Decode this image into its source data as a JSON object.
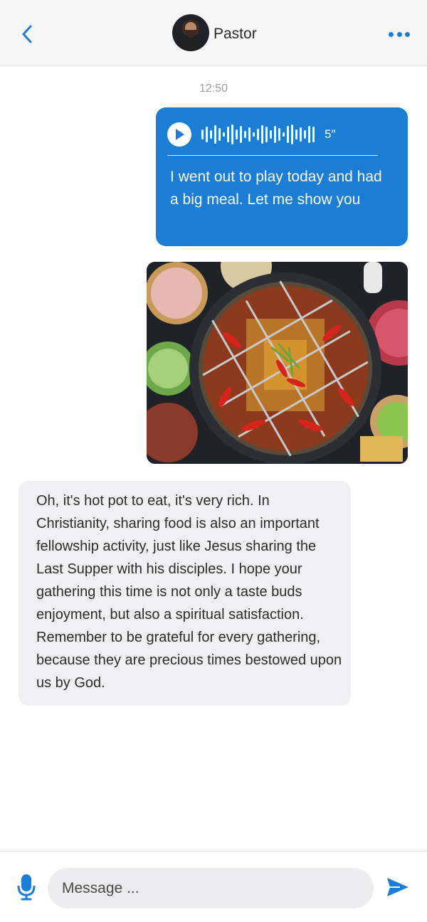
{
  "header": {
    "contact_name": "Pastor",
    "back_icon": "chevron-left-icon",
    "more_icon": "more-dots-icon",
    "accent_color": "#1c7dd6"
  },
  "conversation": {
    "timestamp": "12:50",
    "outgoing_voice": {
      "duration": "5″",
      "transcript": "I went out to play today and had a big meal. Let me show you",
      "bubble_color": "#1b7dd4"
    },
    "outgoing_image": {
      "description_icon": "hot-pot-photo"
    },
    "incoming_text": "Oh, it's hot pot to eat, it's very rich. In Christianity, sharing food is also an important fellowship activity, just like Jesus sharing the Last Supper with his disciples. I hope your gathering this time is not only a taste buds enjoyment, but also a spiritual satisfaction. Remember to be grateful for every gathering, because they are precious times bestowed upon us by God."
  },
  "composer": {
    "placeholder": "Message ...",
    "mic_icon": "microphone-icon",
    "send_icon": "send-icon"
  }
}
